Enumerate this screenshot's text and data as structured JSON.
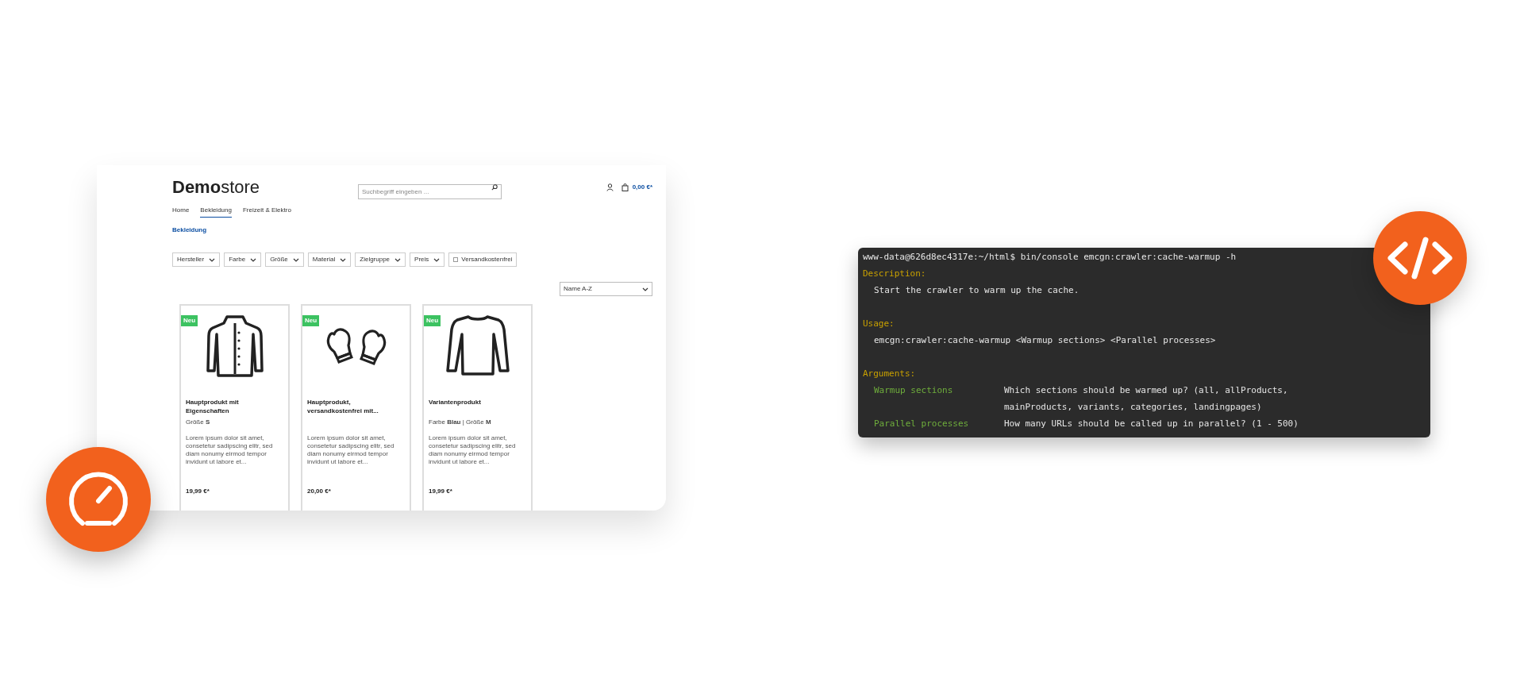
{
  "store": {
    "logo_bold": "Demo",
    "logo_light": "store",
    "search": {
      "placeholder": "Suchbegriff eingeben ..."
    },
    "cart_total": "0,00 €*",
    "nav": [
      {
        "label": "Home",
        "selected": false
      },
      {
        "label": "Bekleidung",
        "selected": true
      },
      {
        "label": "Freizeit & Elektro",
        "selected": false
      }
    ],
    "breadcrumb": "Bekleidung",
    "filters": [
      {
        "kind": "dropdown",
        "label": "Hersteller"
      },
      {
        "kind": "dropdown",
        "label": "Farbe"
      },
      {
        "kind": "dropdown",
        "label": "Größe"
      },
      {
        "kind": "dropdown",
        "label": "Material"
      },
      {
        "kind": "dropdown",
        "label": "Zielgruppe"
      },
      {
        "kind": "dropdown",
        "label": "Preis"
      },
      {
        "kind": "checkbox",
        "label": "Versandkostenfrei",
        "checked": false
      }
    ],
    "sort": "Name A-Z",
    "products": [
      {
        "badge": "Neu",
        "title": "Hauptprodukt mit Eigenschaften",
        "meta": "Größe **S**",
        "description": "Lorem ipsum dolor sit amet, consetetur sadipscing elitr, sed diam nonumy eirmod tempor invidunt ut labore et...",
        "price": "19,99 €*"
      },
      {
        "badge": "Neu",
        "title": "Hauptprodukt, versandkostenfrei mit...",
        "description": "Lorem ipsum dolor sit amet, consetetur sadipscing elitr, sed diam nonumy eirmod tempor invidunt ut labore et...",
        "price": "20,00 €*"
      },
      {
        "badge": "Neu",
        "title": "Variantenprodukt",
        "meta": "Farbe **Blau** | Größe **M**",
        "description": "Lorem ipsum dolor sit amet, consetetur sadipscing elitr, sed diam nonumy eirmod tempor invidunt ut labore et...",
        "price": "19,99 €*"
      }
    ]
  },
  "terminal": {
    "command": "www-data@626d8ec4317e:~/html$ bin/console emcgn:crawler:cache-warmup -h",
    "sections": [
      {
        "heading": "Description:",
        "lines": [
          "Start the crawler to warm up the cache."
        ]
      },
      {
        "heading": "Usage:",
        "lines": [
          "emcgn:crawler:cache-warmup <Warmup sections> <Parallel processes>"
        ]
      },
      {
        "heading": "Arguments:",
        "arguments": [
          {
            "name": "Warmup sections",
            "description": [
              "Which sections should be warmed up? (all, allProducts,",
              "mainProducts, variants, categories, landingpages)"
            ]
          },
          {
            "name": "Parallel processes",
            "description": [
              "How many URLs should be called up in parallel? (1 - 500)"
            ]
          }
        ]
      }
    ]
  }
}
